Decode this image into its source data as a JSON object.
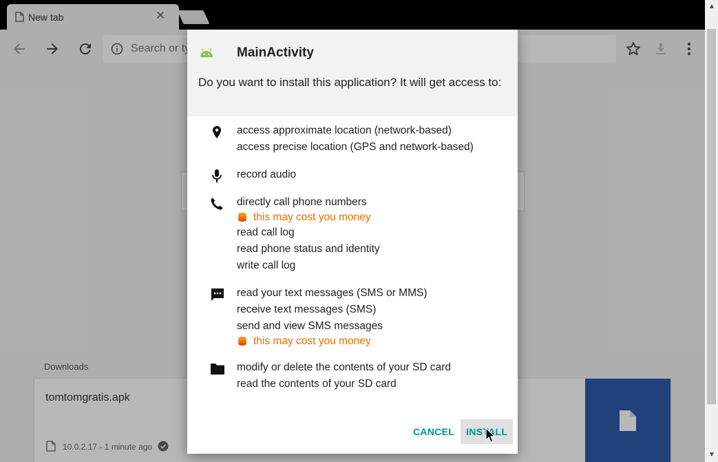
{
  "browser": {
    "tab_title": "New tab",
    "close_glyph": "✕",
    "omnibox_placeholder": "Search or ty",
    "icons": [
      "page-icon",
      "close-icon",
      "back-arrow-icon",
      "forward-arrow-icon",
      "reload-icon",
      "info-icon",
      "star-icon",
      "download-icon",
      "menu-dots-icon"
    ]
  },
  "downloads": {
    "label": "Downloads",
    "file_name": "tomtomgratis.apk",
    "meta": "10.0.2.17 - 1 minute ago"
  },
  "scrollbar": {
    "up_glyph": "▲",
    "down_glyph": "▼"
  },
  "dialog": {
    "title": "MainActivity",
    "question": "Do you want to install this application? It will get access to:",
    "groups": {
      "location": {
        "icon": "location-pin-icon",
        "lines": [
          "access approximate location (network-based)",
          "access precise location (GPS and network-based)"
        ]
      },
      "microphone": {
        "icon": "microphone-icon",
        "lines": [
          "record audio"
        ]
      },
      "phone": {
        "icon": "phone-icon",
        "lines": [
          "directly call phone numbers",
          "read call log",
          "read phone status and identity",
          "write call log"
        ],
        "warning": "this may cost you money"
      },
      "sms": {
        "icon": "sms-icon",
        "lines": [
          "read your text messages (SMS or MMS)",
          "receive text messages (SMS)",
          "send and view SMS messages"
        ],
        "warning": "this may cost you money"
      },
      "storage": {
        "icon": "folder-icon",
        "lines": [
          "modify or delete the contents of your SD card",
          "read the contents of your SD card"
        ]
      }
    },
    "cancel_label": "CANCEL",
    "install_label": "INSTALL"
  },
  "colors": {
    "accent": "#009688",
    "warning": "#ef6c00",
    "android_green": "#8bc34a",
    "thumb_blue": "#2e5aa9"
  }
}
